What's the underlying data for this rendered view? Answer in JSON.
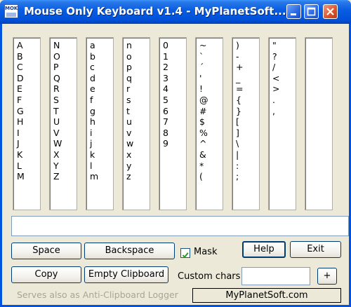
{
  "window": {
    "title": "Mouse Only Keyboard v1.4 - MyPlanetSoft....",
    "icon_text": "MOK",
    "icons": {
      "app": "keyboard-app-icon",
      "minimize": "minimize-icon",
      "maximize": "maximize-icon",
      "close": "close-icon"
    }
  },
  "columns": [
    {
      "chars": [
        "A",
        "B",
        "C",
        "D",
        "E",
        "F",
        "G",
        "H",
        "I",
        "J",
        "K",
        "L",
        "M"
      ]
    },
    {
      "chars": [
        "N",
        "O",
        "P",
        "Q",
        "R",
        "S",
        "T",
        "U",
        "V",
        "W",
        "X",
        "Y",
        "Z"
      ]
    },
    {
      "chars": [
        "a",
        "b",
        "c",
        "d",
        "e",
        "f",
        "g",
        "h",
        "i",
        "j",
        "k",
        "l",
        "m"
      ]
    },
    {
      "chars": [
        "n",
        "o",
        "p",
        "q",
        "r",
        "s",
        "t",
        "u",
        "v",
        "w",
        "x",
        "y",
        "z"
      ]
    },
    {
      "chars": [
        "0",
        "1",
        "2",
        "3",
        "4",
        "5",
        "6",
        "7",
        "8",
        "9"
      ]
    },
    {
      "chars": [
        "~",
        "`",
        "´",
        "'",
        "!",
        "@",
        "#",
        "$",
        "%",
        "^",
        "&",
        "*",
        "("
      ]
    },
    {
      "chars": [
        ")",
        "-",
        "+",
        "_",
        "=",
        "{",
        "}",
        "[",
        "]",
        "\\",
        "|",
        ":",
        ";"
      ]
    },
    {
      "chars": [
        "\"",
        "?",
        "/",
        "<",
        ">",
        ".",
        ","
      ]
    },
    {
      "chars": []
    }
  ],
  "output": {
    "value": ""
  },
  "buttons": {
    "space": "Space",
    "backspace": "Backspace",
    "copy": "Copy",
    "empty_clipboard": "Empty Clipboard",
    "help": "Help",
    "exit": "Exit",
    "plus": "+"
  },
  "mask": {
    "label": "Mask",
    "checked": true
  },
  "custom_chars": {
    "label": "Custom chars",
    "value": ""
  },
  "footer": {
    "note": "Serves also as Anti-Clipboard Logger",
    "link": "MyPlanetSoft.com"
  }
}
